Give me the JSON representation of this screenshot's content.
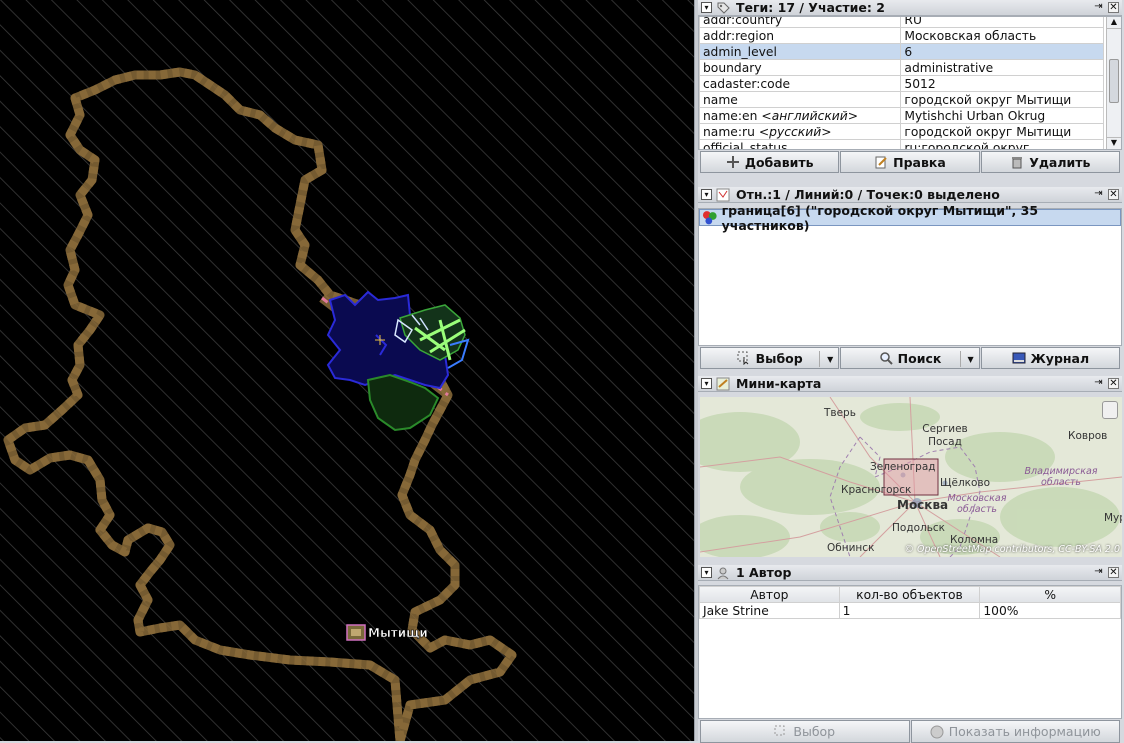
{
  "map": {
    "place_label": "Мытищи"
  },
  "tags_panel": {
    "title": "Теги: 17 / Участие: 2",
    "rows": [
      {
        "key": "addr:country",
        "key_note": "",
        "value": "RU"
      },
      {
        "key": "addr:region",
        "key_note": "",
        "value": "Московская область"
      },
      {
        "key": "admin_level",
        "key_note": "",
        "value": "6"
      },
      {
        "key": "boundary",
        "key_note": "",
        "value": "administrative"
      },
      {
        "key": "cadaster:code",
        "key_note": "",
        "value": "5012"
      },
      {
        "key": "name",
        "key_note": "",
        "value": "городской округ Мытищи"
      },
      {
        "key": "name:en",
        "key_note": "<английский>",
        "value": "Mytishchi Urban Okrug"
      },
      {
        "key": "name:ru",
        "key_note": "<русский>",
        "value": "городской округ Мытищи"
      },
      {
        "key": "official_status",
        "key_note": "",
        "value": "ru:городской округ"
      }
    ],
    "selected_row": 2,
    "buttons": {
      "add": "Добавить",
      "edit": "Правка",
      "delete": "Удалить"
    }
  },
  "selection_panel": {
    "title": "Отн.:1 / Линий:0 / Точек:0 выделено",
    "items": [
      "граница[6] (\"городской округ Мытищи\", 35 участников)"
    ],
    "buttons": {
      "select": "Выбор",
      "search": "Поиск",
      "history": "Журнал"
    }
  },
  "minimap_panel": {
    "title": "Мини-карта",
    "cities": [
      "Тверь",
      "Сергиев Посад",
      "Ковров",
      "Зеленоград",
      "Щёлково",
      "Красногорск",
      "Москва",
      "Подольск",
      "Коломна",
      "Обнинск",
      "Мур"
    ],
    "regions": [
      "Владимирская область",
      "Московская область"
    ],
    "attribution": "© OpenStreetMap contributors, CC-BY-SA 2.0"
  },
  "authors_panel": {
    "title": "1 Автор",
    "columns": [
      "Автор",
      "кол-во объектов",
      "%"
    ],
    "rows": [
      {
        "author": "Jake Strine",
        "count": "1",
        "percent": "100%"
      }
    ],
    "buttons": {
      "select": "Выбор",
      "info": "Показать информацию"
    }
  },
  "colors": {
    "boundary_casing": "#b0905a",
    "boundary_dash": "#e07a9a",
    "selected_row": "#c7d9ef",
    "map_bg": "#000000"
  }
}
